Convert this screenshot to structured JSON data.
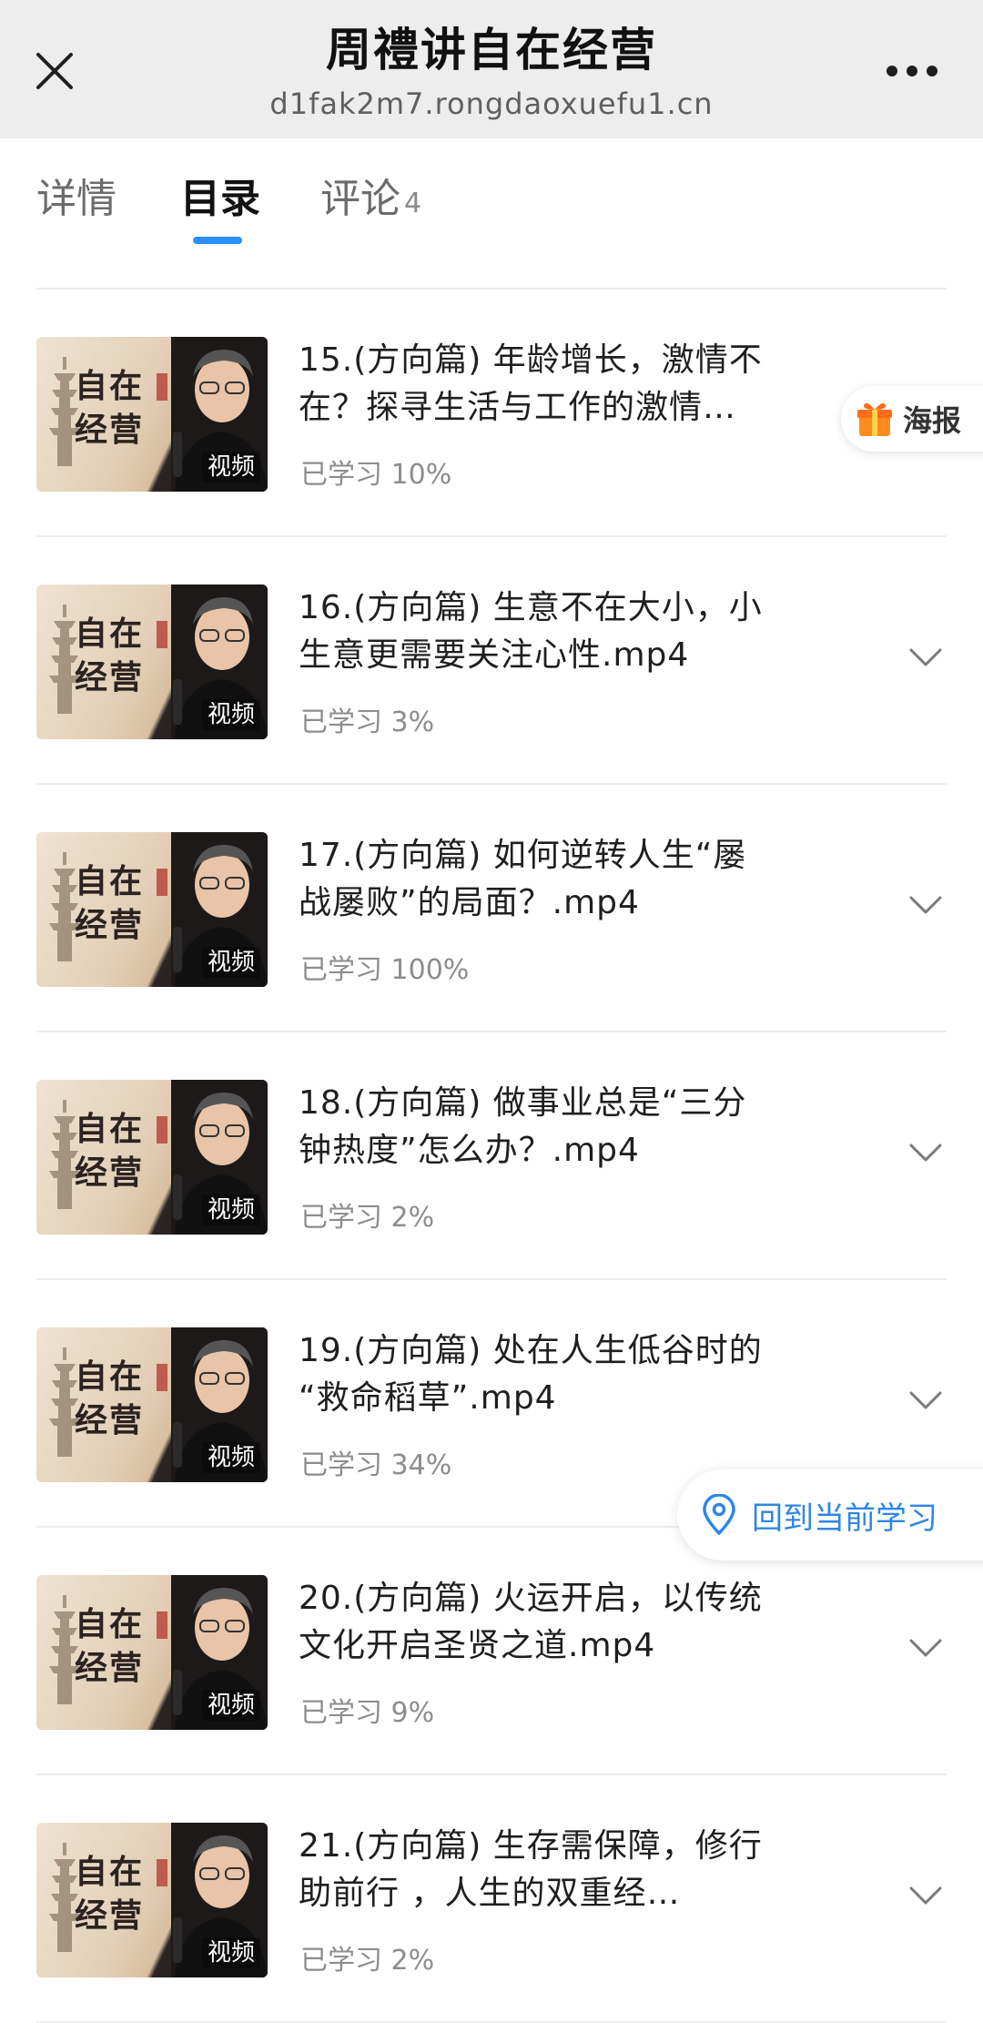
{
  "header": {
    "title": "周禮讲自在经营",
    "url": "d1fak2m7.rongdaoxuefu1.cn",
    "close_icon": "close-icon",
    "more_icon": "more-dots-icon"
  },
  "tabs": [
    {
      "label": "详情",
      "active": false
    },
    {
      "label": "目录",
      "active": true
    },
    {
      "label": "评论",
      "count": "4",
      "active": false
    }
  ],
  "thumbnail": {
    "calligraphy_line1": "自在",
    "calligraphy_line2": "经营",
    "tag": "视频"
  },
  "colors": {
    "accent": "#2a8ff7",
    "link_blue": "#2f86e6",
    "gift_orange": "#ff8a1f"
  },
  "lessons": [
    {
      "title_line1": "15.(方向篇) 年龄增长，激情不",
      "title_line2": "在？探寻生活与工作的激情…",
      "progress": "已学习 10%",
      "chevron": false
    },
    {
      "title_line1": "16.(方向篇) 生意不在大小，小",
      "title_line2": "生意更需要关注心性.mp4",
      "progress": "已学习 3%",
      "chevron": true
    },
    {
      "title_line1": "17.(方向篇) 如何逆转人生“屡",
      "title_line2": "战屡败”的局面？.mp4",
      "progress": "已学习 100%",
      "chevron": true
    },
    {
      "title_line1": "18.(方向篇) 做事业总是“三分",
      "title_line2": "钟热度”怎么办？.mp4",
      "progress": "已学习 2%",
      "chevron": true
    },
    {
      "title_line1": "19.(方向篇) 处在人生低谷时的",
      "title_line2": "“救命稻草”.mp4",
      "progress": "已学习 34%",
      "chevron": true
    },
    {
      "title_line1": "20.(方向篇) 火运开启，以传统",
      "title_line2": "文化开启圣贤之道.mp4",
      "progress": "已学习 9%",
      "chevron": true
    },
    {
      "title_line1": "21.(方向篇) 生存需保障，修行",
      "title_line2": "助前行 ，人生的双重经…",
      "progress": "已学习 2%",
      "chevron": true
    }
  ],
  "floating": {
    "poster_label": "海报",
    "poster_icon": "gift-icon",
    "back_label": "回到当前学习",
    "back_icon": "location-pin-icon"
  }
}
